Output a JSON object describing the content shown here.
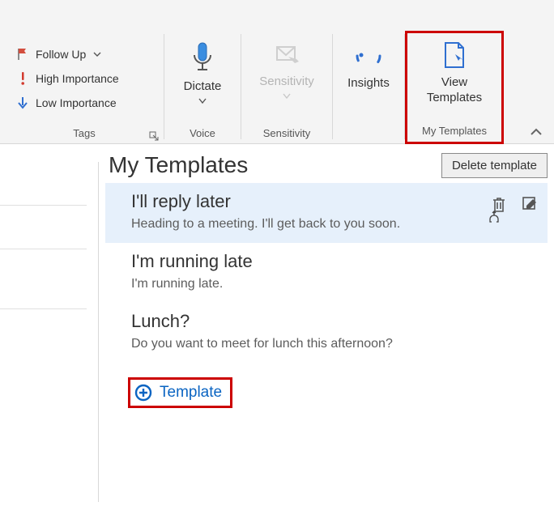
{
  "ribbon": {
    "tags": {
      "follow_up": "Follow Up",
      "high_importance": "High Importance",
      "low_importance": "Low Importance",
      "label": "Tags"
    },
    "voice": {
      "btn": "Dictate",
      "label": "Voice"
    },
    "sensitivity": {
      "btn": "Sensitivity",
      "label": "Sensitivity"
    },
    "insights": {
      "btn": "Insights"
    },
    "templates": {
      "btn_line1": "View",
      "btn_line2": "Templates",
      "label": "My Templates"
    }
  },
  "pane": {
    "title": "My Templates",
    "delete_btn": "Delete template",
    "add_btn": "Template",
    "templates": [
      {
        "title": "I'll reply later",
        "body": "Heading to a meeting. I'll get back to you soon."
      },
      {
        "title": "I'm running late",
        "body": "I'm running late."
      },
      {
        "title": "Lunch?",
        "body": "Do you want to meet for lunch this afternoon?"
      }
    ]
  }
}
